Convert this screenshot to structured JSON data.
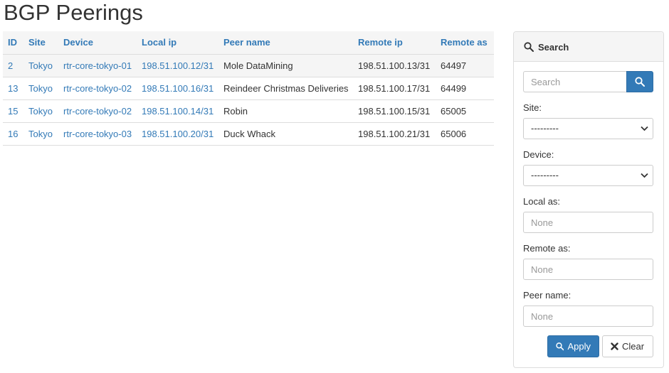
{
  "page": {
    "title": "BGP Peerings"
  },
  "table": {
    "columns": [
      "ID",
      "Site",
      "Device",
      "Local ip",
      "Peer name",
      "Remote ip",
      "Remote as"
    ],
    "rows": [
      {
        "id": "2",
        "site": "Tokyo",
        "device": "rtr-core-tokyo-01",
        "local_ip": "198.51.100.12/31",
        "peer_name": "Mole DataMining",
        "remote_ip": "198.51.100.13/31",
        "remote_as": "64497"
      },
      {
        "id": "13",
        "site": "Tokyo",
        "device": "rtr-core-tokyo-02",
        "local_ip": "198.51.100.16/31",
        "peer_name": "Reindeer Christmas Deliveries",
        "remote_ip": "198.51.100.17/31",
        "remote_as": "64499"
      },
      {
        "id": "15",
        "site": "Tokyo",
        "device": "rtr-core-tokyo-02",
        "local_ip": "198.51.100.14/31",
        "peer_name": "Robin",
        "remote_ip": "198.51.100.15/31",
        "remote_as": "65005"
      },
      {
        "id": "16",
        "site": "Tokyo",
        "device": "rtr-core-tokyo-03",
        "local_ip": "198.51.100.20/31",
        "peer_name": "Duck Whack",
        "remote_ip": "198.51.100.21/31",
        "remote_as": "65006"
      }
    ]
  },
  "search_panel": {
    "title": "Search",
    "search_placeholder": "Search",
    "site_label": "Site:",
    "site_value": "---------",
    "device_label": "Device:",
    "device_value": "---------",
    "local_as_label": "Local as:",
    "local_as_placeholder": "None",
    "remote_as_label": "Remote as:",
    "remote_as_placeholder": "None",
    "peer_name_label": "Peer name:",
    "peer_name_placeholder": "None",
    "apply_label": "Apply",
    "clear_label": "Clear"
  },
  "colors": {
    "link": "#337ab7",
    "primary": "#337ab7",
    "header_bg": "#f5f5f5"
  },
  "icons": {
    "search": "search-icon",
    "clear": "close-icon",
    "select": "chevron-down-icon"
  }
}
